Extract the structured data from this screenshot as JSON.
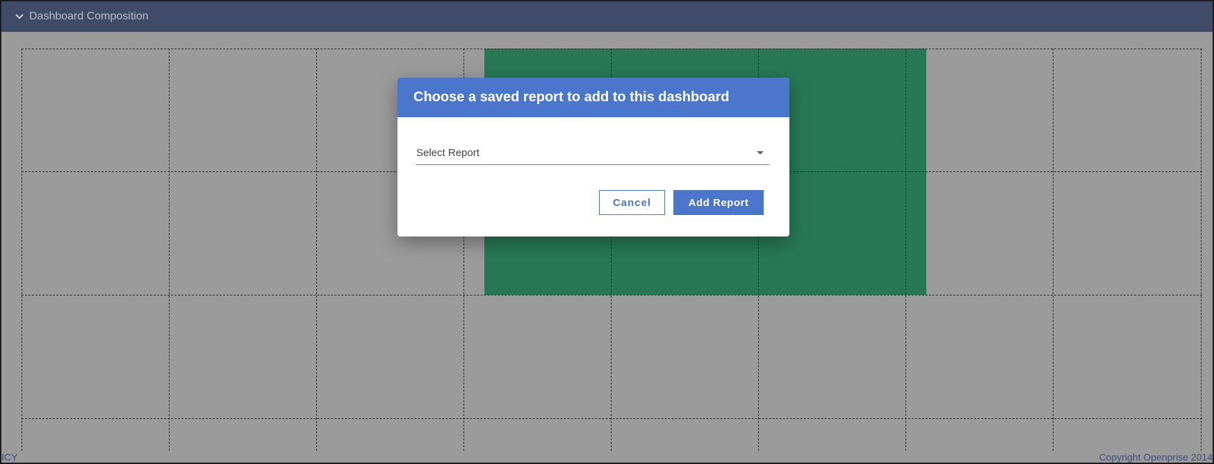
{
  "header": {
    "title": "Dashboard Composition",
    "icon": "chevron-down-icon"
  },
  "footer": {
    "left_text": "ICY",
    "right_text": "Copyright Openprise 2014"
  },
  "modal": {
    "title": "Choose a saved report to add to this dashboard",
    "select_placeholder": "Select Report",
    "cancel_label": "Cancel",
    "add_label": "Add Report"
  },
  "colors": {
    "header_bg": "#404b68",
    "accent": "#4a76cc",
    "highlight": "#287856",
    "overlay_bg": "#9b9b9b"
  }
}
